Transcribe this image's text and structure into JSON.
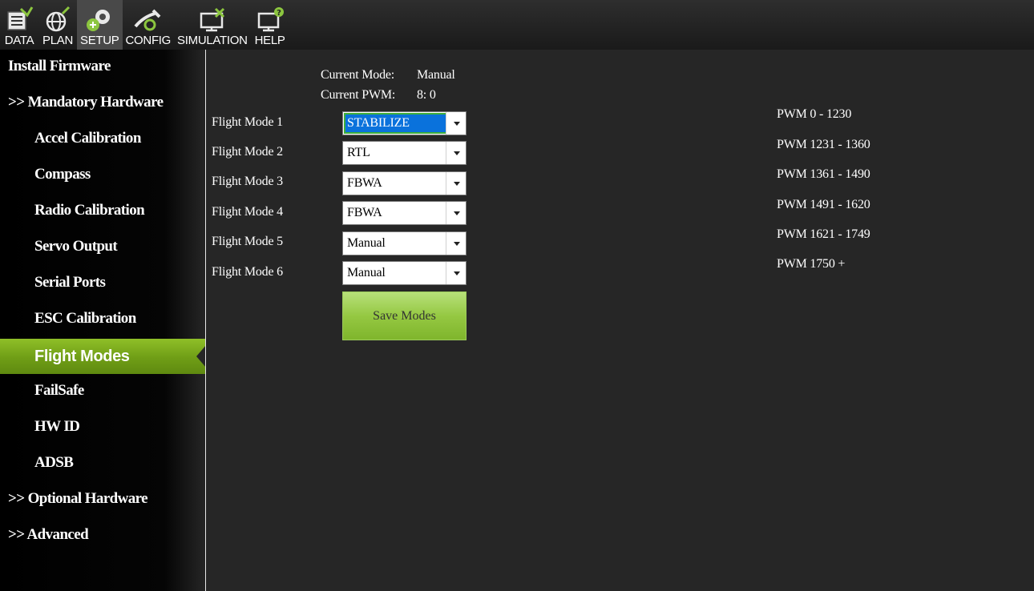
{
  "menu": [
    {
      "label": "DATA",
      "icon": "data-icon",
      "active": false
    },
    {
      "label": "PLAN",
      "icon": "plan-icon",
      "active": false
    },
    {
      "label": "SETUP",
      "icon": "setup-icon",
      "active": true
    },
    {
      "label": "CONFIG",
      "icon": "config-icon",
      "active": false
    },
    {
      "label": "SIMULATION",
      "icon": "simulation-icon",
      "active": false
    },
    {
      "label": "HELP",
      "icon": "help-icon",
      "active": false
    }
  ],
  "sidebar": {
    "items": [
      {
        "label": "Install Firmware",
        "level": 0
      },
      {
        "label": ">> Mandatory Hardware",
        "level": 0
      },
      {
        "label": "Accel Calibration",
        "level": 1
      },
      {
        "label": "Compass",
        "level": 1
      },
      {
        "label": "Radio Calibration",
        "level": 1
      },
      {
        "label": "Servo Output",
        "level": 1
      },
      {
        "label": "Serial Ports",
        "level": 1
      },
      {
        "label": "ESC Calibration",
        "level": 1
      },
      {
        "label": "Flight Modes",
        "level": 1,
        "active": true
      },
      {
        "label": "FailSafe",
        "level": 1
      },
      {
        "label": "HW ID",
        "level": 1
      },
      {
        "label": "ADSB",
        "level": 1
      },
      {
        "label": ">> Optional Hardware",
        "level": 0
      },
      {
        "label": ">> Advanced",
        "level": 0
      }
    ]
  },
  "status": {
    "current_mode_label": "Current Mode:",
    "current_mode_value": "Manual",
    "current_pwm_label": "Current PWM:",
    "current_pwm_value": "8: 0"
  },
  "flight_modes": [
    {
      "label": "Flight Mode 1",
      "value": "STABILIZE",
      "selected": true
    },
    {
      "label": "Flight Mode 2",
      "value": "RTL"
    },
    {
      "label": "Flight Mode 3",
      "value": "FBWA"
    },
    {
      "label": "Flight Mode 4",
      "value": "FBWA"
    },
    {
      "label": "Flight Mode 5",
      "value": "Manual"
    },
    {
      "label": "Flight Mode 6",
      "value": "Manual"
    }
  ],
  "pwm_ranges": [
    "PWM 0 - 1230",
    "PWM 1231 - 1360",
    "PWM 1361 - 1490",
    "PWM 1491 - 1620",
    "PWM 1621 - 1749",
    "PWM 1750 +"
  ],
  "save_button_label": "Save Modes",
  "colors": {
    "accent_green": "#7fb52c",
    "selection_blue": "#0a72dc",
    "background": "#262626"
  }
}
